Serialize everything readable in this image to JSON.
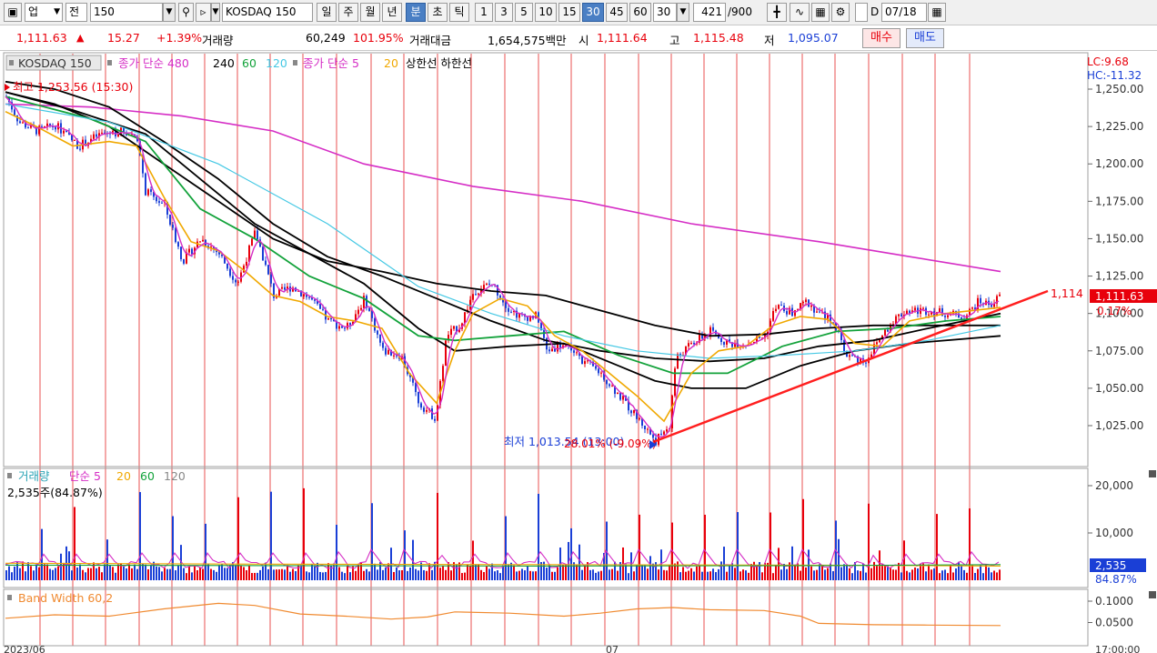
{
  "toolbar": {
    "market": "업",
    "period_type": "전",
    "code": "150",
    "name": "KOSDAQ 150",
    "periods": [
      "일",
      "주",
      "월",
      "년",
      "분",
      "초",
      "틱"
    ],
    "selected_period": "분",
    "minutes": [
      "1",
      "3",
      "5",
      "10",
      "15",
      "30",
      "45",
      "60"
    ],
    "selected_minute": "30",
    "minute_value": "30",
    "count": "421",
    "count_max": "/900",
    "d_label": "D",
    "date": "07/18"
  },
  "quote": {
    "price": "1,111.63",
    "change": "15.27",
    "change_pct": "+1.39%",
    "volume_label": "거래량",
    "volume": "60,249",
    "volume_pct": "101.95%",
    "amount_label": "거래대금",
    "amount": "1,654,575백만",
    "open_label": "시",
    "open": "1,111.64",
    "high_label": "고",
    "high": "1,115.48",
    "low_label": "저",
    "low": "1,095.07",
    "buy_label": "매수",
    "sell_label": "매도"
  },
  "price_panel": {
    "legend": {
      "name": "KOSDAQ 150",
      "ma_long": "종가 단순 480",
      "p240": "240",
      "p60": "60",
      "p120": "120",
      "ma_short": "종가 단순 5",
      "p20": "20",
      "bands": "상한선 하한선"
    },
    "lc": "LC:9.68",
    "hc": "HC:-11.32",
    "high_note": "최고 1,253.56 (15:30)",
    "low_note": "최저 1,013.54 (13:00)",
    "low_note2": "28.01% (-9.09%)",
    "trend_label": "1,114",
    "price_tag": "1,111.63",
    "pct_tag": "0.17%"
  },
  "volume_panel": {
    "legend_name": "거래량",
    "legend_ma": "단순 5",
    "p20": "20",
    "p60": "60",
    "p120": "120",
    "current": "2,535주(84.87%)",
    "tag_value": "2,535",
    "tag_pct": "84.87%"
  },
  "bw_panel": {
    "legend": "Band Width 60,2"
  },
  "axis": {
    "price_ticks": [
      "1,250.00",
      "1,225.00",
      "1,200.00",
      "1,175.00",
      "1,150.00",
      "1,125.00",
      "1,100.00",
      "1,075.00",
      "1,050.00",
      "1,025.00"
    ],
    "volume_ticks": [
      "20,000",
      "10,000"
    ],
    "bw_ticks": [
      "0.1000",
      "0.0500"
    ],
    "bottom_left": "2023/06",
    "bottom_mid": "07",
    "bottom_right": "17:00:00"
  },
  "colors": {
    "up": "#e8000b",
    "down": "#1a3fd6",
    "ma480": "#d52dc5",
    "ma240": "#000000",
    "ma60": "#12a23a",
    "ma120": "#44c8e4",
    "ma5": "#d52dc5",
    "ma20": "#f0a800",
    "trend": "#ff1e1e",
    "bw": "#f08a30"
  }
}
